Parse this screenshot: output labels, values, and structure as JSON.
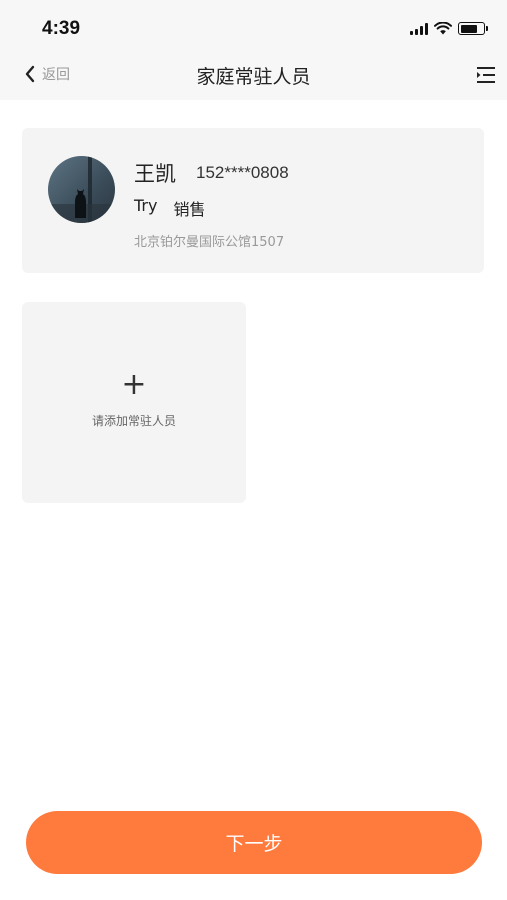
{
  "status_bar": {
    "time": "4:39",
    "battery_level": 0.75
  },
  "nav": {
    "back_label": "返回",
    "title": "家庭常驻人员",
    "back_icon": "chevron-left-icon",
    "menu_icon": "indent-menu-icon"
  },
  "resident": {
    "name": "王凯",
    "phone": "152****0808",
    "nickname": "Try",
    "occupation": "销售",
    "address": "北京铂尔曼国际公馆1507"
  },
  "add_tile": {
    "plus": "+",
    "label": "请添加常驻人员"
  },
  "footer": {
    "next_label": "下一步"
  },
  "colors": {
    "accent": "#ff7a3d",
    "card_bg": "#f4f4f4",
    "header_bg": "#f7f7f7"
  }
}
